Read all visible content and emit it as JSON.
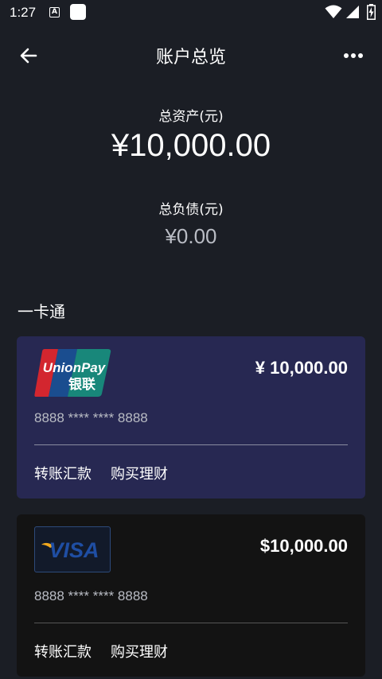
{
  "status_bar": {
    "time": "1:27",
    "a_icon_text": "A"
  },
  "header": {
    "title": "账户总览"
  },
  "summary": {
    "total_assets_label": "总资产(元)",
    "total_assets_value": "¥10,000.00",
    "total_debt_label": "总负债(元)",
    "total_debt_value": "¥0.00"
  },
  "section": {
    "title": "一卡通"
  },
  "cards": [
    {
      "brand": "UnionPay",
      "balance": "¥ 10,000.00",
      "number": "8888 **** **** 8888",
      "actions": [
        "转账汇款",
        "购买理财"
      ],
      "background": "#272852"
    },
    {
      "brand": "VISA",
      "balance": "$10,000.00",
      "number": "8888 **** **** 8888",
      "actions": [
        "转账汇款",
        "购买理财"
      ],
      "background": "#131313"
    }
  ],
  "logos": {
    "unionpay_text": "UnionPay",
    "unionpay_cn": "银联",
    "visa_text": "VISA"
  },
  "colors": {
    "page_background": "#1b1e25",
    "unionpay_red": "#d3262f",
    "unionpay_blue": "#1a4d8f",
    "unionpay_green": "#18877a",
    "visa_blue": "#1a3f8f",
    "visa_gold": "#f2a81d"
  }
}
